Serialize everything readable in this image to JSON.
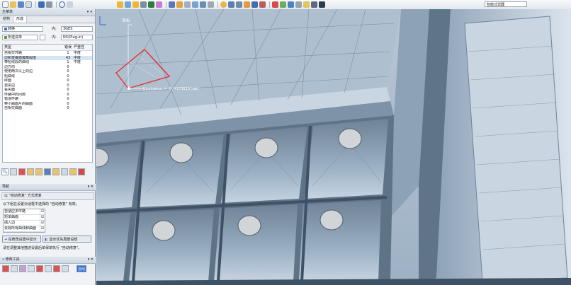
{
  "top_toolbar": {
    "select_value": "智能过滤器"
  },
  "left_panel": {
    "header_title": "主菜单",
    "header_controls": "▾ ✕",
    "tabs": [
      "结构",
      "形成"
    ],
    "form": {
      "field1_value": "转换",
      "field1_label": "内:",
      "field1_right": "3GES",
      "field2_value": "所选清单",
      "field2_label": "内:",
      "field2_right": "NX(Plug-in)"
    },
    "table": {
      "headers": [
        "类型",
        "错误",
        "严重性"
      ],
      "rows": [
        {
          "name": "自相交环路",
          "count": "1",
          "sev": "中度"
        },
        {
          "name": "边和重叠面偏离阈值",
          "count": "43",
          "sev": "中度"
        },
        {
          "name": "带短线段的曲线",
          "count": "1",
          "sev": "中度"
        },
        {
          "name": "边方向",
          "count": "0",
          "sev": ""
        },
        {
          "name": "使用两次以上的边",
          "count": "0",
          "sev": ""
        },
        {
          "name": "短曲线",
          "count": "0",
          "sev": ""
        },
        {
          "name": "碎面",
          "count": "0",
          "sev": ""
        },
        {
          "name": "自由边",
          "count": "0",
          "sev": ""
        },
        {
          "name": "丢失面",
          "count": "0",
          "sev": ""
        },
        {
          "name": "环路中的间隙",
          "count": "0",
          "sev": ""
        },
        {
          "name": "错误环路",
          "count": "0",
          "sev": ""
        },
        {
          "name": "带小曲面片的曲面",
          "count": "0",
          "sev": ""
        },
        {
          "name": "自相交曲面",
          "count": "0",
          "sev": ""
        }
      ]
    }
  },
  "nav_panel": {
    "header_title": "导航",
    "banner": "以 \"自动修复\" 方式修复",
    "description": "以下组在设置对话框中选择的 \"自动修复\" 有效。",
    "items": [
      "自适应多环路",
      "短单曲面",
      "插入边",
      "去除所有曲线和曲面"
    ],
    "btn_settings": "在修改设置中显示",
    "btn_preview": "显示优先局部设想",
    "note": "请在调整其他描述设置后单保单执行 \"自动修复\"。",
    "footer_title": "« 修改工具",
    "footer_btn": "自动"
  },
  "viewport": {
    "dimension_label": "目标",
    "distance_text": "Distance = 0.0129815[mm]"
  }
}
